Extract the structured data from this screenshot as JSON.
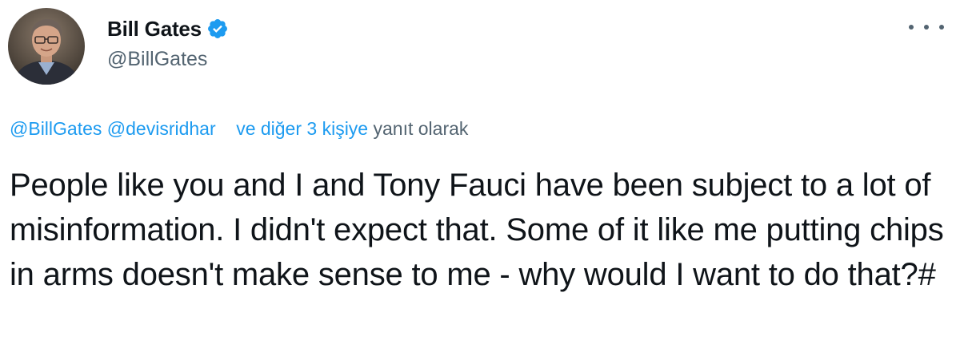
{
  "author": {
    "display_name": "Bill Gates",
    "handle": "@BillGates",
    "verified": true,
    "avatar_icon": "profile-photo"
  },
  "menu": {
    "icon": "more-options-icon"
  },
  "reply_context": {
    "mention_1": "@BillGates",
    "mention_2": "@devisridhar",
    "others": "ve diğer 3 kişiye",
    "suffix": "yanıt olarak"
  },
  "tweet": {
    "text": "People like you and I and Tony Fauci have been subject to a lot of misinformation. I didn't expect that. Some of it like me putting chips in arms doesn't make sense to me - why would I want to do that?#"
  },
  "colors": {
    "link": "#1d9bf0",
    "secondary_text": "#536471",
    "primary_text": "#0f1419",
    "verified_badge": "#1d9bf0"
  }
}
